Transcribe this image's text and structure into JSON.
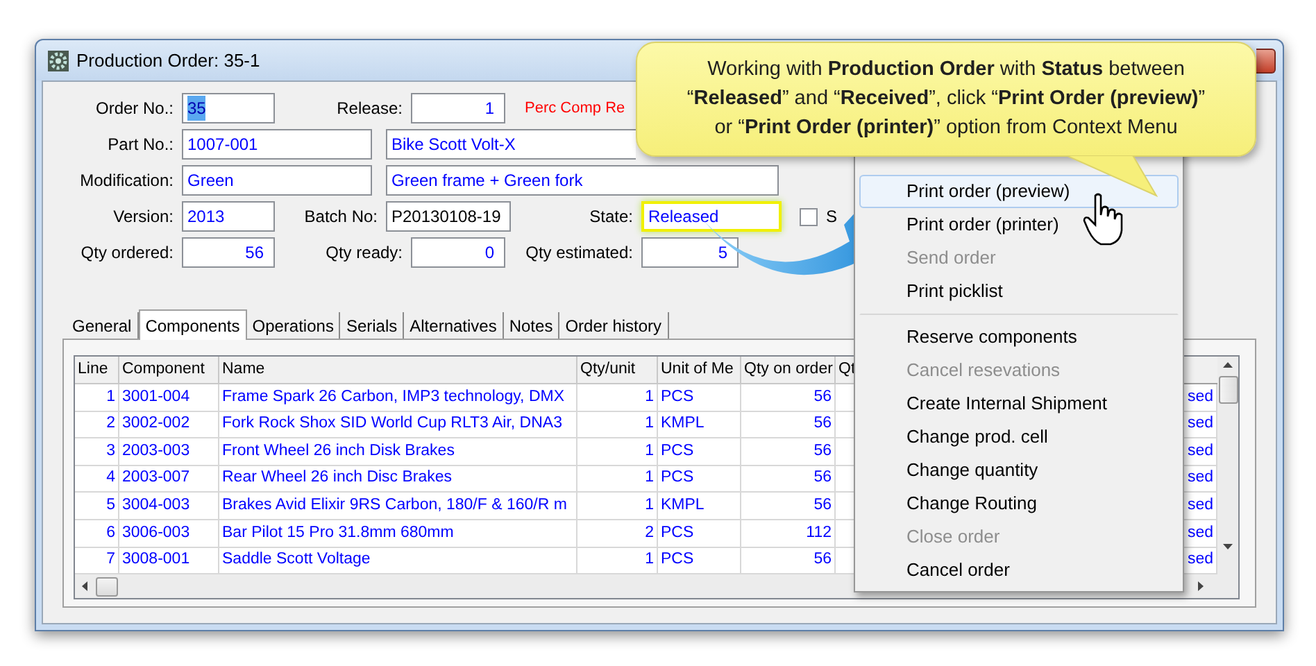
{
  "window": {
    "title": "Production Order: 35-1"
  },
  "form": {
    "order_no": {
      "label": "Order No.:",
      "value": "35",
      "selected": true
    },
    "release": {
      "label": "Release:",
      "value": "1"
    },
    "perc_comp_note": "Perc Comp Re",
    "part_no": {
      "label": "Part No.:",
      "value": "1007-001",
      "description": "Bike Scott Volt-X"
    },
    "modification": {
      "label": "Modification:",
      "value": "Green",
      "description": "Green frame + Green fork"
    },
    "version": {
      "label": "Version:",
      "value": "2013"
    },
    "batch_no": {
      "label": "Batch No:",
      "value": "P20130108-19"
    },
    "state": {
      "label": "State:",
      "value": "Released",
      "highlighted": true
    },
    "state_checkbox": {
      "label": "S",
      "checked": false
    },
    "qty_ordered": {
      "label": "Qty ordered:",
      "value": "56"
    },
    "qty_ready": {
      "label": "Qty ready:",
      "value": "0"
    },
    "qty_estimated": {
      "label": "Qty estimated:",
      "value": "5"
    }
  },
  "tabs": [
    {
      "label": "General",
      "selected": false
    },
    {
      "label": "Components",
      "selected": true
    },
    {
      "label": "Operations",
      "selected": false
    },
    {
      "label": "Serials",
      "selected": false
    },
    {
      "label": "Alternatives",
      "selected": false
    },
    {
      "label": "Notes",
      "selected": false
    },
    {
      "label": "Order history",
      "selected": false
    }
  ],
  "table": {
    "columns": [
      "Line",
      "Component",
      "Name",
      "Qty/unit",
      "Unit of Me",
      "Qty on order",
      "Qt"
    ],
    "rows": [
      {
        "line": "1",
        "component": "3001-004",
        "name": "Frame Spark 26 Carbon, IMP3 technology, DMX",
        "qty_unit": "1",
        "unit": "PCS",
        "qty_on_order": "56",
        "column_8": "sed"
      },
      {
        "line": "2",
        "component": "3002-002",
        "name": "Fork Rock Shox SID World Cup RLT3 Air, DNA3",
        "qty_unit": "1",
        "unit": "KMPL",
        "qty_on_order": "56",
        "column_8": "sed"
      },
      {
        "line": "3",
        "component": "2003-003",
        "name": "Front Wheel 26 inch Disk Brakes",
        "qty_unit": "1",
        "unit": "PCS",
        "qty_on_order": "56",
        "column_8": "sed"
      },
      {
        "line": "4",
        "component": "2003-007",
        "name": "Rear Wheel 26 inch Disc Brakes",
        "qty_unit": "1",
        "unit": "PCS",
        "qty_on_order": "56",
        "column_8": "sed"
      },
      {
        "line": "5",
        "component": "3004-003",
        "name": "Brakes Avid Elixir 9RS Carbon, 180/F & 160/R m",
        "qty_unit": "1",
        "unit": "KMPL",
        "qty_on_order": "56",
        "column_8": "sed"
      },
      {
        "line": "6",
        "component": "3006-003",
        "name": "Bar Pilot 15 Pro 31.8mm 680mm",
        "qty_unit": "2",
        "unit": "PCS",
        "qty_on_order": "112",
        "column_8": "sed"
      },
      {
        "line": "7",
        "component": "3008-001",
        "name": "Saddle Scott Voltage",
        "qty_unit": "1",
        "unit": "PCS",
        "qty_on_order": "56",
        "column_8": "sed"
      }
    ]
  },
  "context_menu": {
    "items": [
      {
        "label": "Print order (preview)",
        "disabled": false,
        "selected": true,
        "separator_after": false
      },
      {
        "label": "Print order (printer)",
        "disabled": false,
        "selected": false,
        "separator_after": false
      },
      {
        "label": "Send order",
        "disabled": true,
        "selected": false,
        "separator_after": false
      },
      {
        "label": "Print picklist",
        "disabled": false,
        "selected": false,
        "separator_after": true
      },
      {
        "label": "Reserve components",
        "disabled": false,
        "selected": false,
        "separator_after": false
      },
      {
        "label": "Cancel resevations",
        "disabled": true,
        "selected": false,
        "separator_after": false
      },
      {
        "label": "Create Internal Shipment",
        "disabled": false,
        "selected": false,
        "separator_after": false
      },
      {
        "label": "Change prod. cell",
        "disabled": false,
        "selected": false,
        "separator_after": false
      },
      {
        "label": "Change quantity",
        "disabled": false,
        "selected": false,
        "separator_after": false
      },
      {
        "label": "Change Routing",
        "disabled": false,
        "selected": false,
        "separator_after": false
      },
      {
        "label": "Close order",
        "disabled": true,
        "selected": false,
        "separator_after": false
      },
      {
        "label": "Cancel order",
        "disabled": false,
        "selected": false,
        "separator_after": false
      }
    ]
  },
  "callout": {
    "lines": [
      "Working with **Production  Order** with **Status** between",
      "“**Released**” and “**Received**”, click “**Print Order (preview)**”",
      "or “**Print Order (printer)**” option from Context Menu"
    ]
  }
}
